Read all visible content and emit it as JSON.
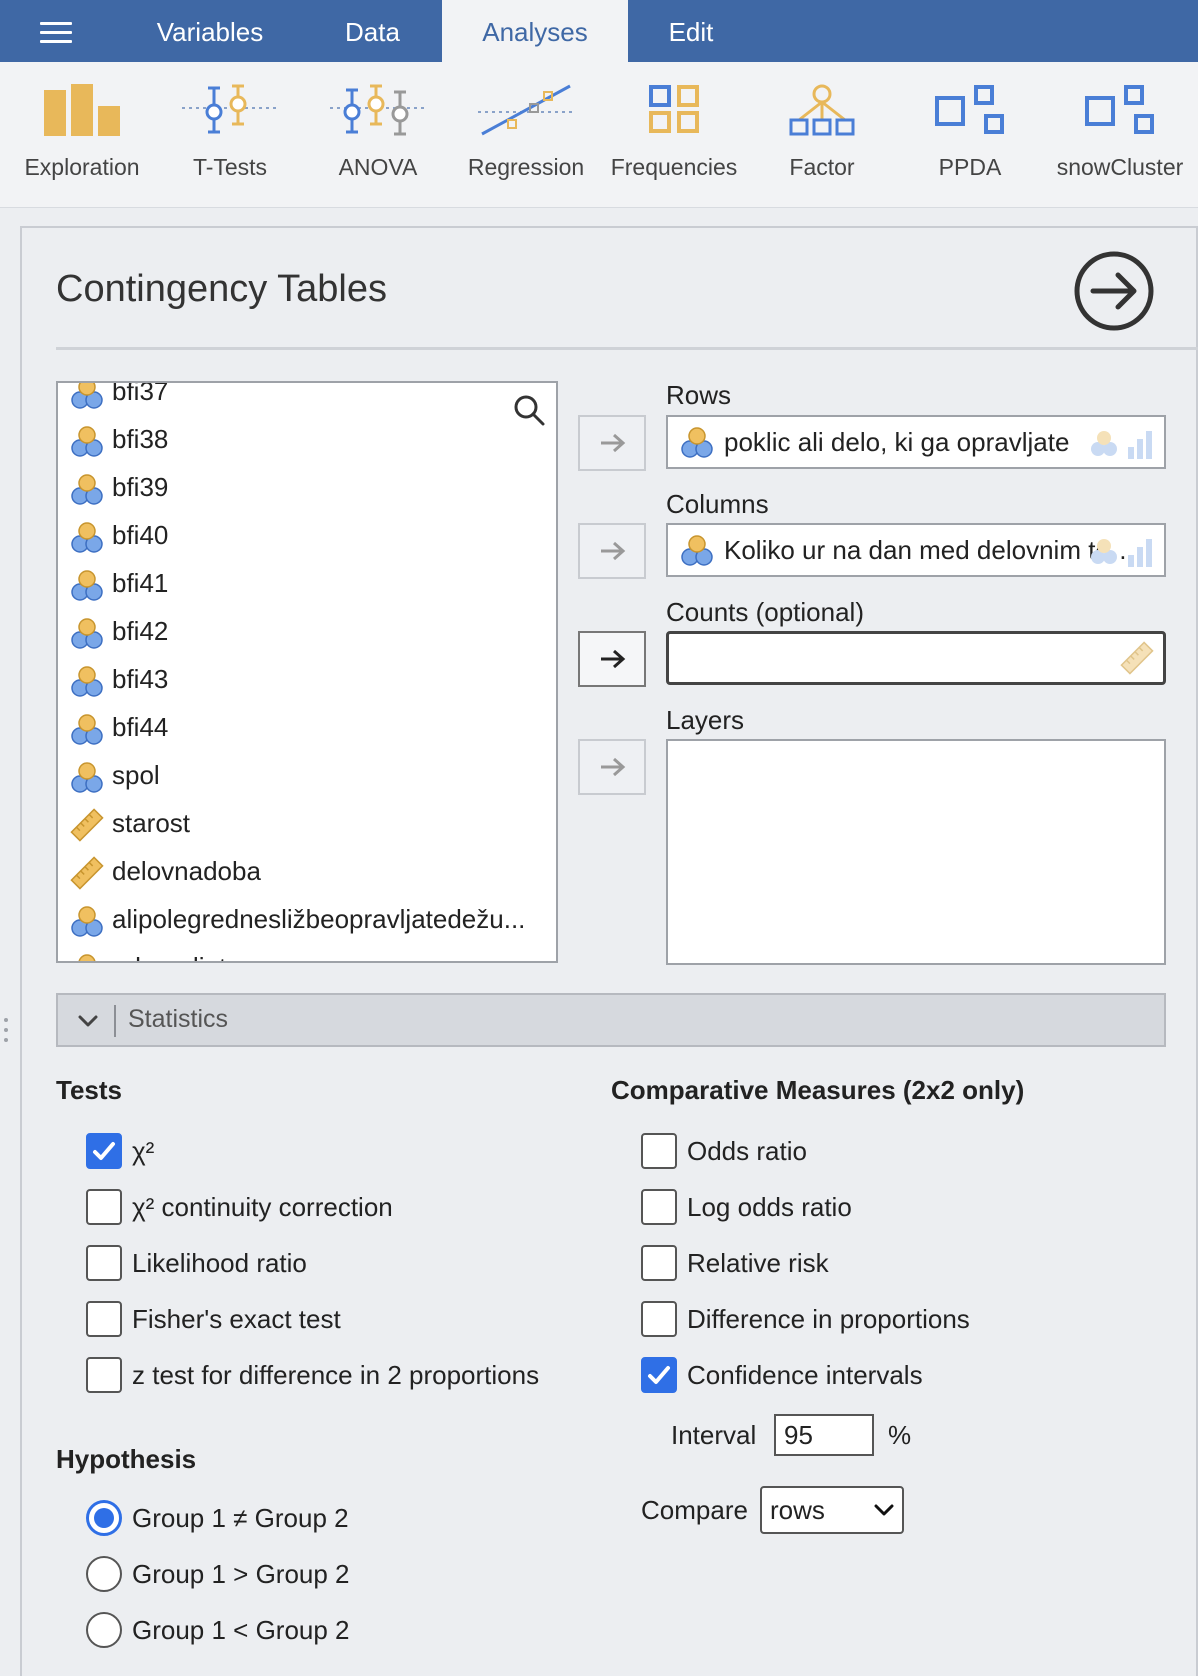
{
  "menu": {
    "tabs": [
      {
        "label": "Variables"
      },
      {
        "label": "Data"
      },
      {
        "label": "Analyses"
      },
      {
        "label": "Edit"
      }
    ]
  },
  "ribbon": {
    "items": [
      {
        "label": "Exploration",
        "icon": "exploration-icon"
      },
      {
        "label": "T-Tests",
        "icon": "ttests-icon"
      },
      {
        "label": "ANOVA",
        "icon": "anova-icon"
      },
      {
        "label": "Regression",
        "icon": "regression-icon"
      },
      {
        "label": "Frequencies",
        "icon": "frequencies-icon"
      },
      {
        "label": "Factor",
        "icon": "factor-icon"
      },
      {
        "label": "PPDA",
        "icon": "module-icon"
      },
      {
        "label": "snowCluster",
        "icon": "module-icon"
      }
    ]
  },
  "panel": {
    "title": "Contingency Tables"
  },
  "variables": [
    {
      "name": "bfi37",
      "type": "nominal"
    },
    {
      "name": "bfi38",
      "type": "nominal"
    },
    {
      "name": "bfi39",
      "type": "nominal"
    },
    {
      "name": "bfi40",
      "type": "nominal"
    },
    {
      "name": "bfi41",
      "type": "nominal"
    },
    {
      "name": "bfi42",
      "type": "nominal"
    },
    {
      "name": "bfi43",
      "type": "nominal"
    },
    {
      "name": "bfi44",
      "type": "nominal"
    },
    {
      "name": "spol",
      "type": "nominal"
    },
    {
      "name": "starost",
      "type": "continuous"
    },
    {
      "name": "delovnadoba",
      "type": "continuous"
    },
    {
      "name": "alipolegrednesližbeopravljatedežu...",
      "type": "nominal"
    },
    {
      "name": "adenudiet...",
      "type": "nominal"
    }
  ],
  "targets": {
    "rows": {
      "label": "Rows",
      "value": "poklic ali delo, ki ga opravljate"
    },
    "columns": {
      "label": "Columns",
      "value": "Koliko ur na dan med delovnim ted..."
    },
    "counts": {
      "label": "Counts (optional)",
      "value": ""
    },
    "layers": {
      "label": "Layers"
    }
  },
  "statistics": {
    "section_label": "Statistics",
    "tests": {
      "heading": "Tests",
      "options": [
        {
          "label": "χ²",
          "checked": true
        },
        {
          "label": "χ² continuity correction",
          "checked": false
        },
        {
          "label": "Likelihood ratio",
          "checked": false
        },
        {
          "label": "Fisher's exact test",
          "checked": false
        },
        {
          "label": "z test for difference in 2 proportions",
          "checked": false
        }
      ]
    },
    "comparative": {
      "heading": "Comparative Measures (2x2 only)",
      "options": [
        {
          "label": "Odds ratio",
          "checked": false
        },
        {
          "label": "Log odds ratio",
          "checked": false
        },
        {
          "label": "Relative risk",
          "checked": false
        },
        {
          "label": "Difference in proportions",
          "checked": false
        },
        {
          "label": "Confidence intervals",
          "checked": true
        }
      ],
      "interval_label": "Interval",
      "interval_value": "95",
      "interval_unit": "%",
      "compare_label": "Compare",
      "compare_value": "rows"
    },
    "hypothesis": {
      "heading": "Hypothesis",
      "options": [
        {
          "label": "Group 1 ≠ Group 2",
          "selected": true
        },
        {
          "label": "Group 1 > Group 2",
          "selected": false
        },
        {
          "label": "Group 1 < Group 2",
          "selected": false
        }
      ]
    }
  },
  "colors": {
    "menubar": "#3f68a5",
    "accent": "#2f6fe6",
    "ribbon_orange": "#e8b85a",
    "ribbon_blue": "#4a7ed6"
  }
}
